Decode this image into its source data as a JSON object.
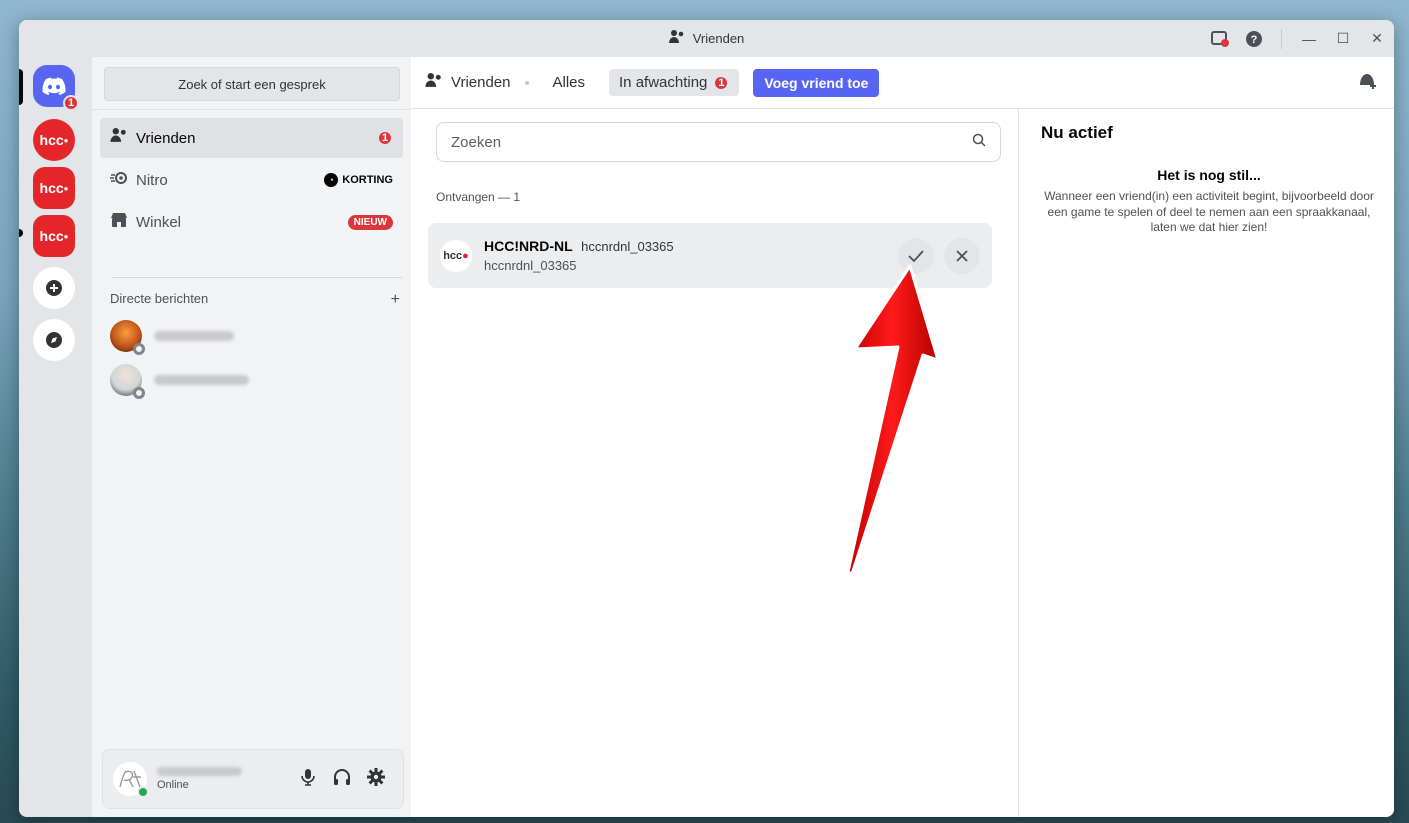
{
  "window": {
    "title": "Vrienden"
  },
  "guilds": {
    "home_badge": "1"
  },
  "sidebar": {
    "search_placeholder": "Zoek of start een gesprek",
    "nav": [
      {
        "label": "Vrienden",
        "badge": "1"
      },
      {
        "label": "Nitro",
        "badge": "KORTING"
      },
      {
        "label": "Winkel",
        "badge": "NIEUW"
      }
    ],
    "dm_header": "Directe berichten",
    "dm_add": "+"
  },
  "user": {
    "status": "Online"
  },
  "header": {
    "title": "Vrienden",
    "tabs": [
      {
        "label": "Alles"
      },
      {
        "label": "In afwachting",
        "badge": "1"
      }
    ],
    "add_friend": "Voeg vriend toe"
  },
  "search": {
    "placeholder": "Zoeken"
  },
  "pending": {
    "section": "Ontvangen — 1",
    "requests": [
      {
        "name": "HCC!NRD-NL",
        "tag": "hccnrdnl_03365",
        "sub": "hccnrdnl_03365"
      }
    ]
  },
  "active_now": {
    "title": "Nu actief",
    "heading": "Het is nog stil...",
    "body": "Wanneer een vriend(in) een activiteit begint, bijvoorbeeld door een game te spelen of deel te nemen aan een spraakkanaal, laten we dat hier zien!"
  },
  "colors": {
    "accent": "#5865f2",
    "badge_red": "#da373c",
    "hcc_red": "#e4262a",
    "online": "#23a55a",
    "arrow": "#ff0000"
  }
}
